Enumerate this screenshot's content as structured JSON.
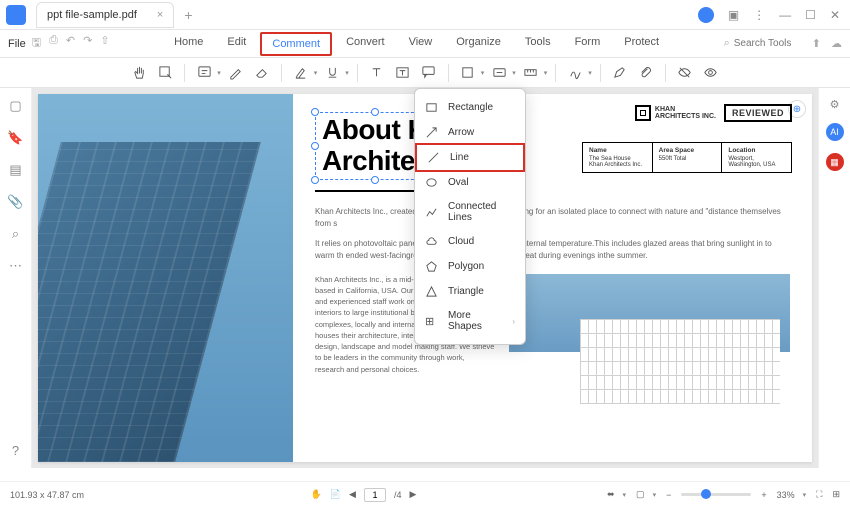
{
  "titlebar": {
    "tab_name": "ppt file-sample.pdf"
  },
  "menubar": {
    "file": "File",
    "tabs": [
      "Home",
      "Edit",
      "Comment",
      "Convert",
      "View",
      "Organize",
      "Tools",
      "Form",
      "Protect"
    ],
    "active_index": 2,
    "search_placeholder": "Search Tools"
  },
  "dropdown": {
    "items": [
      {
        "icon": "rectangle",
        "label": "Rectangle"
      },
      {
        "icon": "arrow",
        "label": "Arrow"
      },
      {
        "icon": "line",
        "label": "Line"
      },
      {
        "icon": "oval",
        "label": "Oval"
      },
      {
        "icon": "connected",
        "label": "Connected Lines"
      },
      {
        "icon": "cloud",
        "label": "Cloud"
      },
      {
        "icon": "polygon",
        "label": "Polygon"
      },
      {
        "icon": "triangle",
        "label": "Triangle"
      },
      {
        "icon": "more",
        "label": "More Shapes",
        "chevron": true
      }
    ],
    "hover_index": 2
  },
  "document": {
    "heading_line1": "About K",
    "heading_line2": "Archite",
    "logo_name": "KHAN",
    "logo_sub": "ARCHITECTS INC.",
    "reviewed": "REVIEWED",
    "table": {
      "c1_h": "Name",
      "c1_v": "The Sea House Khan Architects Inc.",
      "c2_h": "Area Space",
      "c2_v": "550ft Total",
      "c3_h": "Location",
      "c3_v": "Westport, Washington, USA"
    },
    "p1": "Khan Architects Inc., created thi                                                  ashington for a family looking for an isolated place to connect with nature and \"distance themselves from s",
    "p2": "It relies on photovoltaic panels fo                                                g designs to regulate its internal temperature.This includes glazed areas that bring sunlight in to warm th                                                 ended west-facingroof provides shade from solar heat during evenings inthe summer.",
    "p3": "Khan Architects Inc., is a mid-sized architecture firm based in California, USA. Our exceptionally talented and experienced staff work on projects from boutique interiors to large institutional buildings and airport complexes, locally and internationally. Our firm houses their architecture, interior design, graphic design, landscape and model making staff. We strieve to be leaders in the community through work, research and personal choices."
  },
  "statusbar": {
    "dimensions": "101.93 x 47.87 cm",
    "page_current": "1",
    "page_total": "/4",
    "zoom": "33%"
  }
}
